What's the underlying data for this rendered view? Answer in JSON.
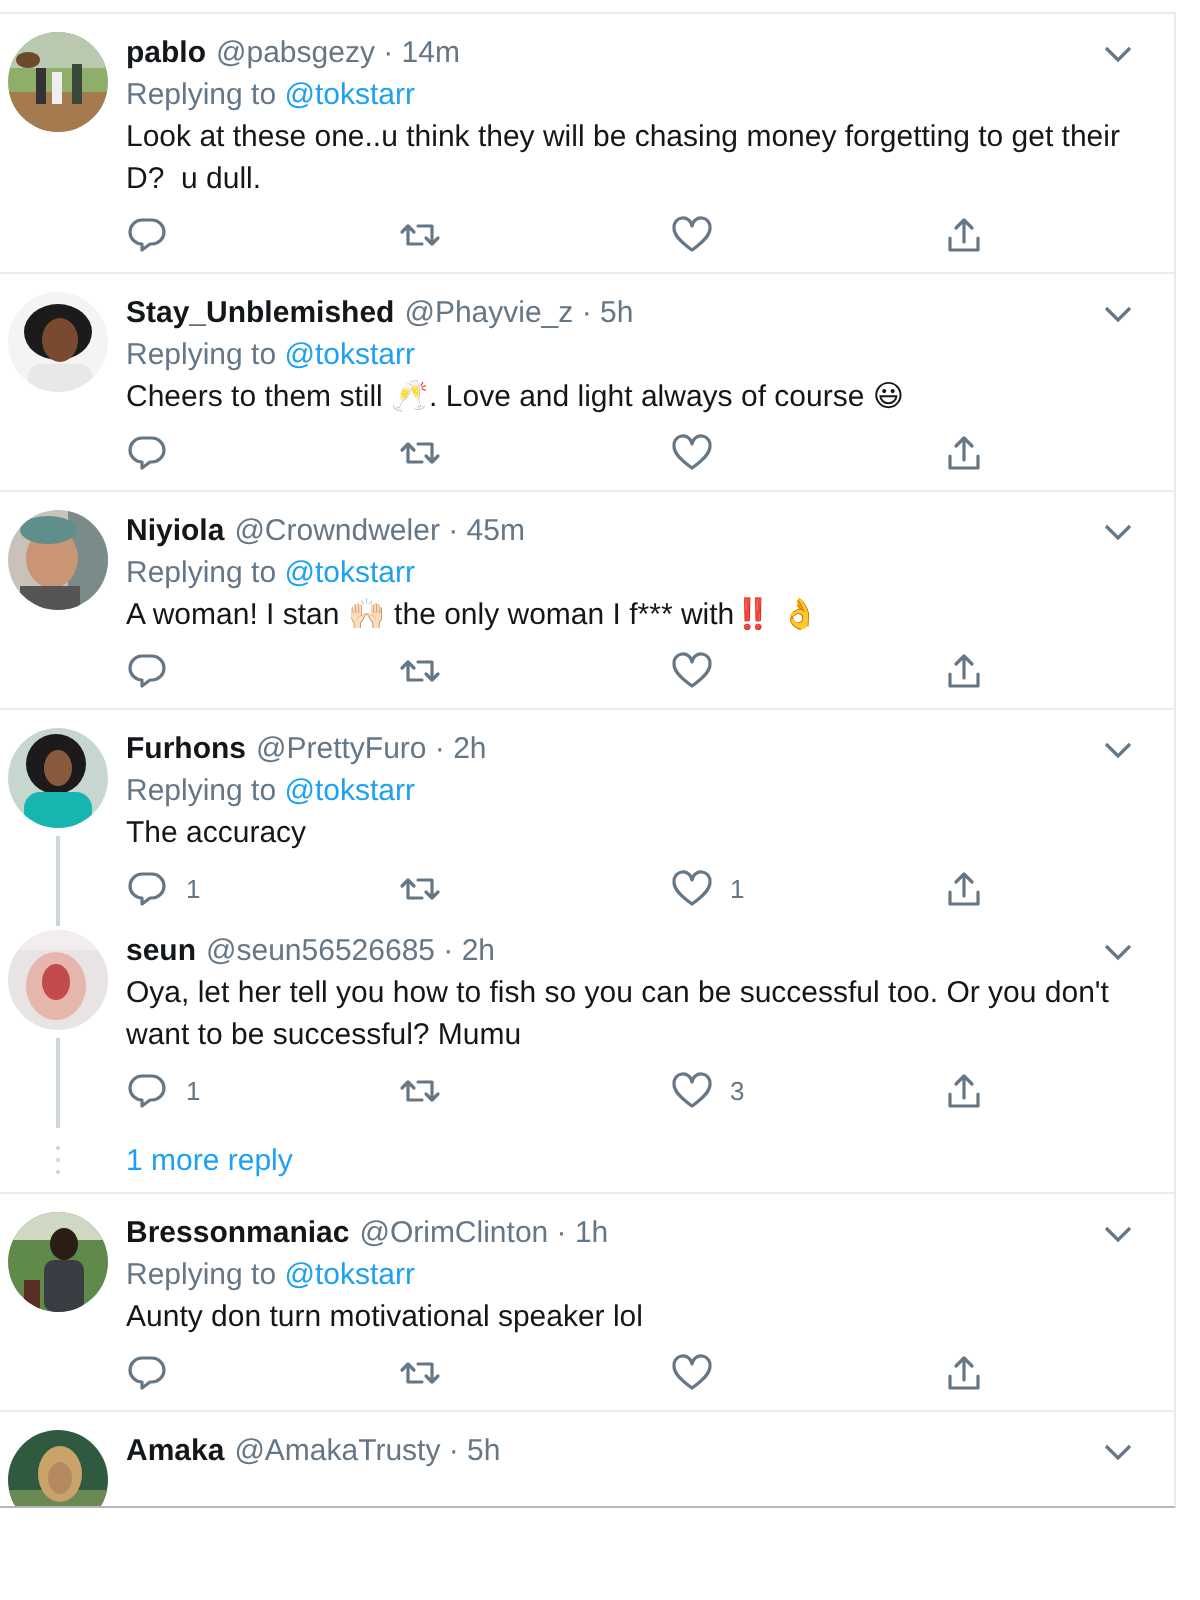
{
  "tweets": [
    {
      "kind": "tweet",
      "name": "pablo",
      "meta": "@pabsgezy · 14m",
      "replying_prefix": "Replying to",
      "replying_to": "@tokstarr",
      "text": "Look at these one..u think they will be chasing money forgetting to get their D?  u dull.",
      "thread": false
    },
    {
      "kind": "tweet",
      "name": "Stay_Unblemished",
      "meta": "@Phayvie_z · 5h",
      "replying_prefix": "Replying to",
      "replying_to": "@tokstarr",
      "text": "Cheers to them still 🥂. Love and light always of course 😃",
      "thread": false
    },
    {
      "kind": "tweet",
      "name": "Niyiola",
      "meta": "@Crowndweler · 45m",
      "replying_prefix": "Replying to",
      "replying_to": "@tokstarr",
      "text": "A woman! I stan 🙌🏻 the only woman I f*** with‼️ 👌",
      "thread": false
    },
    {
      "kind": "tweet",
      "name": "Furhons",
      "meta": "@PrettyFuro · 2h",
      "replying_prefix": "Replying to",
      "replying_to": "@tokstarr",
      "text": "The accuracy",
      "replies": "1",
      "likes": "1",
      "thread": true
    },
    {
      "kind": "tweet",
      "name": "seun",
      "meta": "@seun56526685 · 2h",
      "text": "Oya, let her tell you how to fish so you can be successful too. Or you don't want to be successful? Mumu",
      "replies": "1",
      "likes": "3",
      "thread": true
    },
    {
      "kind": "more",
      "label": "1 more reply"
    },
    {
      "kind": "tweet",
      "name": "Bressonmaniac",
      "meta": "@OrimClinton · 1h",
      "replying_prefix": "Replying to",
      "replying_to": "@tokstarr",
      "text": "Aunty don turn motivational speaker lol",
      "thread": false
    },
    {
      "kind": "tweet",
      "name": "Amaka",
      "meta": "@AmakaTrusty · 5h",
      "thread": false
    }
  ]
}
